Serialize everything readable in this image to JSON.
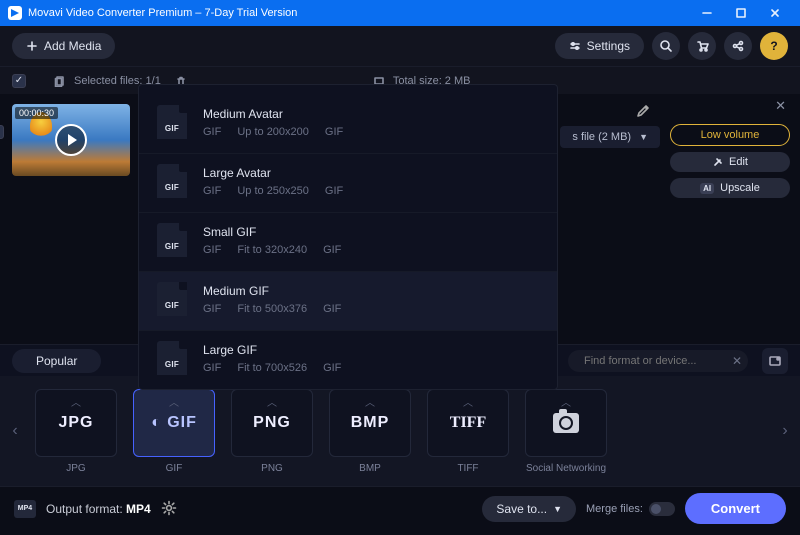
{
  "titlebar": {
    "title": "Movavi Video Converter Premium – 7-Day Trial Version"
  },
  "toolbar": {
    "add_media": "Add Media",
    "settings": "Settings"
  },
  "infobar": {
    "selected": "Selected files: 1/1",
    "total_size": "Total size: 2 MB"
  },
  "thumb": {
    "duration": "00:00:30"
  },
  "file_chip": {
    "text": "s file (2 MB)"
  },
  "rightcol": {
    "low_volume": "Low volume",
    "edit": "Edit",
    "upscale": "Upscale"
  },
  "popup_icon_label": "GIF",
  "popup": [
    {
      "title": "Medium Avatar",
      "fmt": "GIF",
      "spec": "Up to 200x200",
      "codec": "GIF"
    },
    {
      "title": "Large Avatar",
      "fmt": "GIF",
      "spec": "Up to 250x250",
      "codec": "GIF"
    },
    {
      "title": "Small GIF",
      "fmt": "GIF",
      "spec": "Fit to 320x240",
      "codec": "GIF"
    },
    {
      "title": "Medium GIF",
      "fmt": "GIF",
      "spec": "Fit to 500x376",
      "codec": "GIF"
    },
    {
      "title": "Large GIF",
      "fmt": "GIF",
      "spec": "Fit to 700x526",
      "codec": "GIF"
    }
  ],
  "tabrow": {
    "popular": "Popular",
    "search_placeholder": "Find format or device..."
  },
  "formats": [
    {
      "label": "JPG",
      "logo": "JPG"
    },
    {
      "label": "GIF",
      "logo": "GIF"
    },
    {
      "label": "PNG",
      "logo": "PNG"
    },
    {
      "label": "BMP",
      "logo": "BMP"
    },
    {
      "label": "TIFF",
      "logo": "TIFF"
    },
    {
      "label": "Social Networking",
      "logo": "CAM"
    }
  ],
  "bottom": {
    "badge": "MP4",
    "out_label": "Output format: ",
    "out_value": "MP4",
    "save_to": "Save to...",
    "merge": "Merge files:",
    "convert": "Convert"
  }
}
